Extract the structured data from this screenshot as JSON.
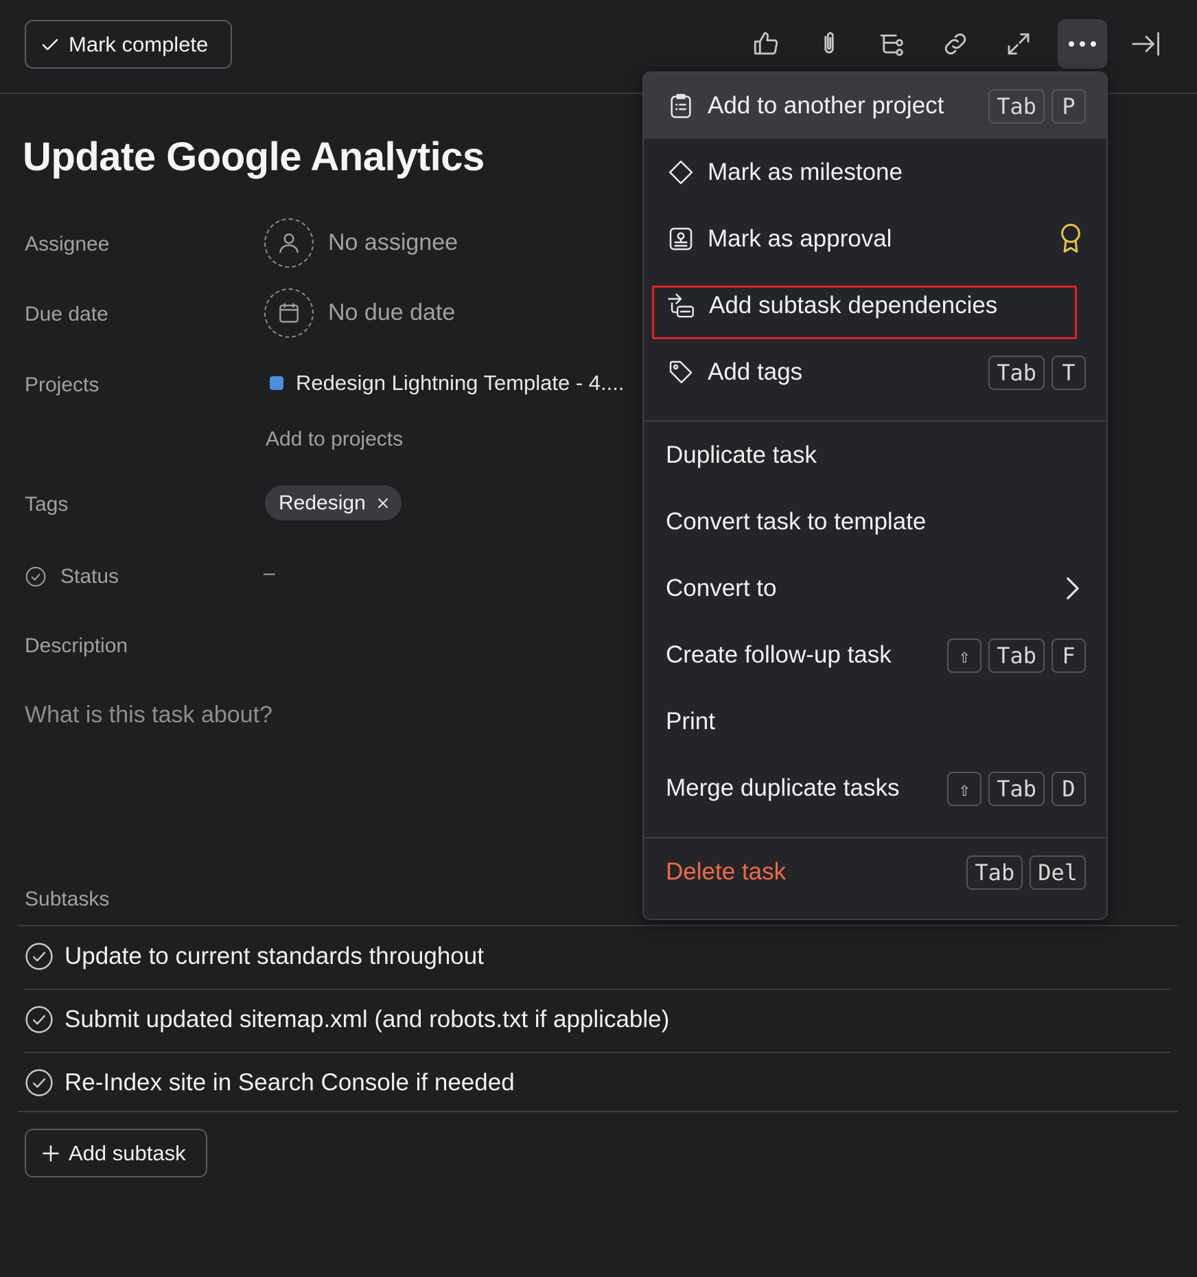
{
  "toolbar": {
    "mark_complete_label": "Mark complete",
    "icons": [
      "thumbs-up-icon",
      "paperclip-icon",
      "subtask-icon",
      "link-icon",
      "expand-icon",
      "more-icon",
      "close-panel-icon"
    ]
  },
  "task": {
    "title": "Update Google Analytics",
    "assignee_label": "Assignee",
    "assignee_value": "No assignee",
    "due_date_label": "Due date",
    "due_date_value": "No due date",
    "projects_label": "Projects",
    "project_name": "Redesign Lightning Template - 4....",
    "add_to_projects": "Add to projects",
    "tags_label": "Tags",
    "tag": "Redesign",
    "status_label": "Status",
    "status_value": "–",
    "description_label": "Description",
    "description_placeholder": "What is this task about?"
  },
  "subtasks": {
    "label": "Subtasks",
    "items": [
      "Update to current standards throughout",
      "Submit updated sitemap.xml (and robots.txt if applicable)",
      "Re-Index site in Search Console if needed"
    ],
    "add_label": "Add subtask"
  },
  "menu": {
    "items": [
      {
        "label": "Add to another project",
        "keys": [
          "Tab",
          "P"
        ]
      },
      {
        "label": "Mark as milestone"
      },
      {
        "label": "Mark as approval"
      },
      {
        "label": "Add subtask dependencies"
      },
      {
        "label": "Add tags",
        "keys": [
          "Tab",
          "T"
        ]
      },
      {
        "label": "Duplicate task"
      },
      {
        "label": "Convert task to template"
      },
      {
        "label": "Convert to"
      },
      {
        "label": "Create follow-up task",
        "keys": [
          "⇧",
          "Tab",
          "F"
        ]
      },
      {
        "label": "Print"
      },
      {
        "label": "Merge duplicate tasks",
        "keys": [
          "⇧",
          "Tab",
          "D"
        ]
      },
      {
        "label": "Delete task",
        "keys": [
          "Tab",
          "Del"
        ]
      }
    ]
  },
  "colors": {
    "background": "#1e1f21",
    "menu_background": "#242528",
    "danger": "#f06a4a",
    "highlight": "#e0202a",
    "approval_badge": "#e8c547",
    "project_color": "#4a8fe0"
  }
}
